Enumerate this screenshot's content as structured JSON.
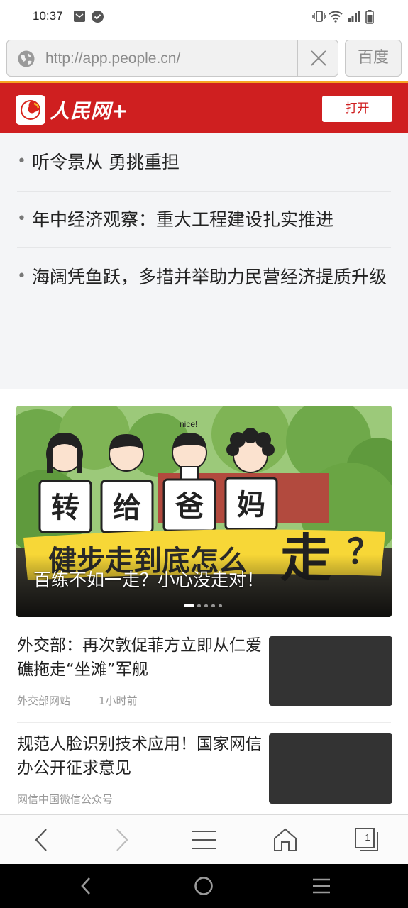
{
  "status_bar": {
    "time": "10:37",
    "left_icons": [
      "message-icon",
      "check-badge-icon"
    ],
    "right_icons": [
      "vibrate-icon",
      "wifi-icon",
      "signal-icon",
      "battery-icon"
    ]
  },
  "browser": {
    "url": "http://app.people.cn/",
    "search_button": "百度",
    "icons": [
      "globe-icon",
      "clear-icon"
    ]
  },
  "site_header": {
    "logo_text": "人民网+",
    "open_button": "打开",
    "color": "#cf1f20"
  },
  "headlines": [
    "听令景从 勇挑重担",
    "年中经济观察：重大工程建设扎实推进",
    "海阔凭鱼跃，多措并举助力民营经济提质升级"
  ],
  "banner": {
    "caption": "百练不如一走？小心没走对！",
    "card_labels": [
      "转",
      "给",
      "爸",
      "妈"
    ],
    "headline": "健步走到底怎么",
    "headline_big": "走",
    "headline_mark": "？",
    "nice_text": "nice!",
    "slide_count": 5,
    "active_slide": 1
  },
  "articles": [
    {
      "title": "外交部：再次敦促菲方立即从仁爱礁拖走“坐滩”军舰",
      "source": "外交部网站",
      "time": "1小时前"
    },
    {
      "title": "规范人脸识别技术应用！国家网信办公开征求意见",
      "source": "网信中国微信公众号",
      "time": ""
    }
  ],
  "toolbar": {
    "icons": [
      "back-icon",
      "forward-icon",
      "menu-icon",
      "home-icon",
      "tabs-icon"
    ],
    "tab_count": "1"
  },
  "system_nav": {
    "icons": [
      "nav-back-icon",
      "nav-home-icon",
      "nav-recents-icon"
    ]
  }
}
